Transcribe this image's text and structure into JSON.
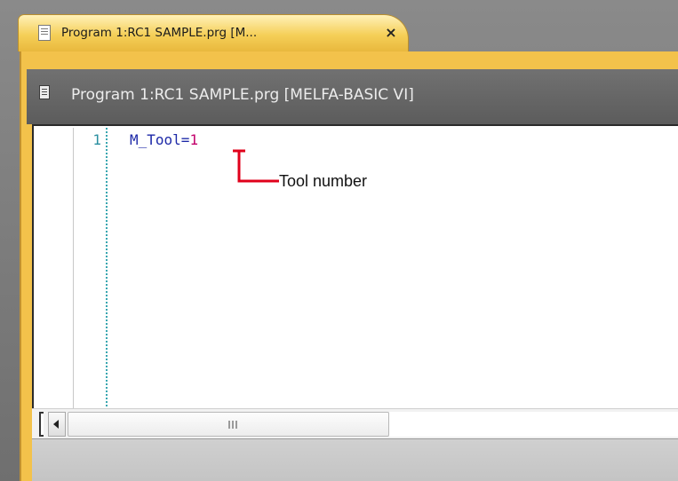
{
  "tab": {
    "title": "Program 1:RC1 SAMPLE.prg   [M...",
    "close_glyph": "×"
  },
  "document": {
    "title": "Program 1:RC1 SAMPLE.prg   [MELFA-BASIC VI]"
  },
  "editor": {
    "lines": [
      {
        "number": "1",
        "var": "M_Tool",
        "op": "=",
        "value": "1"
      }
    ]
  },
  "annotation": {
    "label": "Tool number",
    "color": "#e0001b"
  },
  "icons": {
    "tab_icon": "document-icon",
    "header_icon": "document-icon",
    "scroll_left": "arrow-left-icon"
  },
  "colors": {
    "tab_active": "#f5cf58",
    "frame_gray": "#6f6f6f",
    "keyword": "#1e2aa8",
    "number_literal": "#c2006a",
    "line_number": "#2a8fa0"
  }
}
